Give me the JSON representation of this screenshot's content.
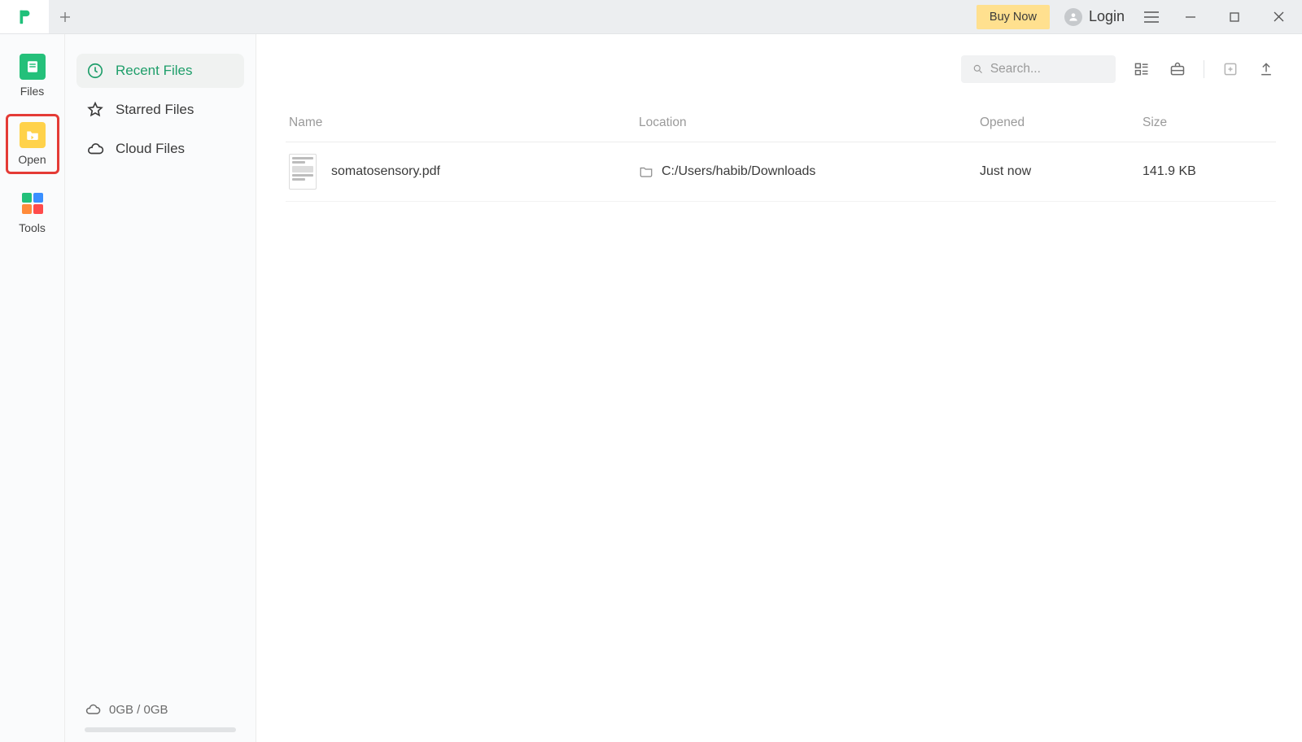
{
  "titlebar": {
    "buy_now": "Buy Now",
    "login": "Login"
  },
  "leftrail": {
    "files": "Files",
    "open": "Open",
    "tools": "Tools"
  },
  "sidebar": {
    "recent": "Recent Files",
    "starred": "Starred Files",
    "cloud": "Cloud Files",
    "storage": "0GB / 0GB"
  },
  "toolbar": {
    "search_placeholder": "Search..."
  },
  "table": {
    "headers": {
      "name": "Name",
      "location": "Location",
      "opened": "Opened",
      "size": "Size"
    },
    "rows": [
      {
        "name": "somatosensory.pdf",
        "location": "C:/Users/habib/Downloads",
        "opened": "Just now",
        "size": "141.9 KB"
      }
    ]
  }
}
